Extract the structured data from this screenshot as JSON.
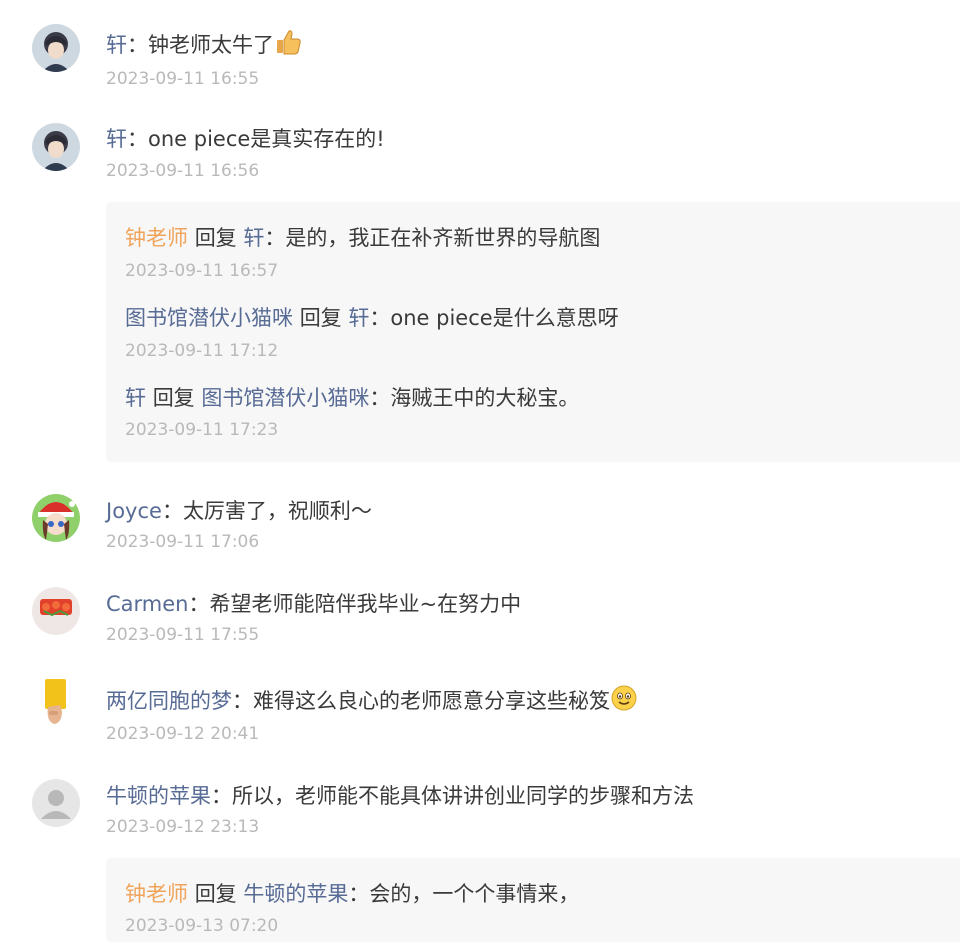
{
  "comments": [
    {
      "author": "轩",
      "text": "钟老师太牛了",
      "emoji": "thumbs-up-icon",
      "time": "2023-09-11 16:55"
    },
    {
      "author": "轩",
      "text": "one piece是真实存在的!",
      "time": "2023-09-11 16:56",
      "replies": [
        {
          "from": "钟老师",
          "verb": "回复",
          "to": "轩",
          "text": "是的，我正在补齐新世界的导航图",
          "time": "2023-09-11 16:57"
        },
        {
          "from": "图书馆潜伏小猫咪",
          "verb": "回复",
          "to": "轩",
          "text": "one piece是什么意思呀",
          "time": "2023-09-11 17:12"
        },
        {
          "from": "轩",
          "verb": "回复",
          "to": "图书馆潜伏小猫咪",
          "text": "海贼王中的大秘宝。",
          "time": "2023-09-11 17:23"
        }
      ]
    },
    {
      "author": "Joyce",
      "text": "太厉害了，祝顺利～",
      "time": "2023-09-11 17:06"
    },
    {
      "author": "Carmen",
      "text": "希望老师能陪伴我毕业~在努力中",
      "time": "2023-09-11 17:55"
    },
    {
      "author": "两亿同胞的梦",
      "text": "难得这么良心的老师愿意分享这些秘笈",
      "emoji": "smile-icon",
      "time": "2023-09-12 20:41"
    },
    {
      "author": "牛顿的苹果",
      "text": "所以，老师能不能具体讲讲创业同学的步骤和方法",
      "time": "2023-09-12 23:13",
      "replies": [
        {
          "from": "钟老师",
          "verb": "回复",
          "to": "牛顿的苹果",
          "text": "会的，一个个事情来，",
          "time": "2023-09-13 07:20"
        }
      ]
    }
  ],
  "separator": "："
}
